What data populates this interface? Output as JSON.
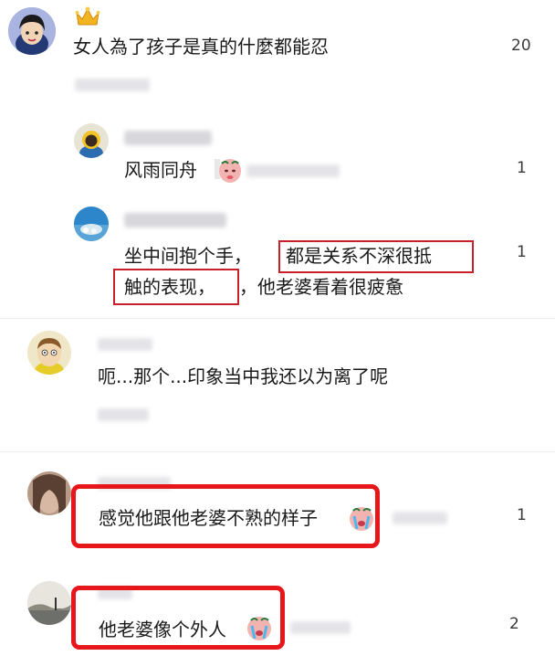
{
  "colors": {
    "highlight_red": "#e6161a",
    "thin_red": "#c8202a",
    "text": "#1a1a1a",
    "count": "#3a3a3a"
  },
  "comments": [
    {
      "text": "女人為了孩子是真的什麼都能忍",
      "likes": "20",
      "badge_icon": "crown-icon"
    },
    {
      "text": "风雨同舟",
      "likes": "1",
      "sticker_icon": "pink-face-sticker-icon"
    },
    {
      "text_part1": "坐中间抱个手，",
      "text_part2": "都是关系不深很抵",
      "text_part3": "触的表现，",
      "text_part4": "，他老婆看着很疲惫",
      "likes": "1"
    },
    {
      "text": "呃...那个...印象当中我还以为离了呢"
    },
    {
      "text": "感觉他跟他老婆不熟的样子",
      "likes": "1",
      "sticker_icon": "crying-face-sticker-icon"
    },
    {
      "text": "他老婆像个外人",
      "likes": "2",
      "sticker_icon": "crying-face-sticker-icon"
    }
  ]
}
